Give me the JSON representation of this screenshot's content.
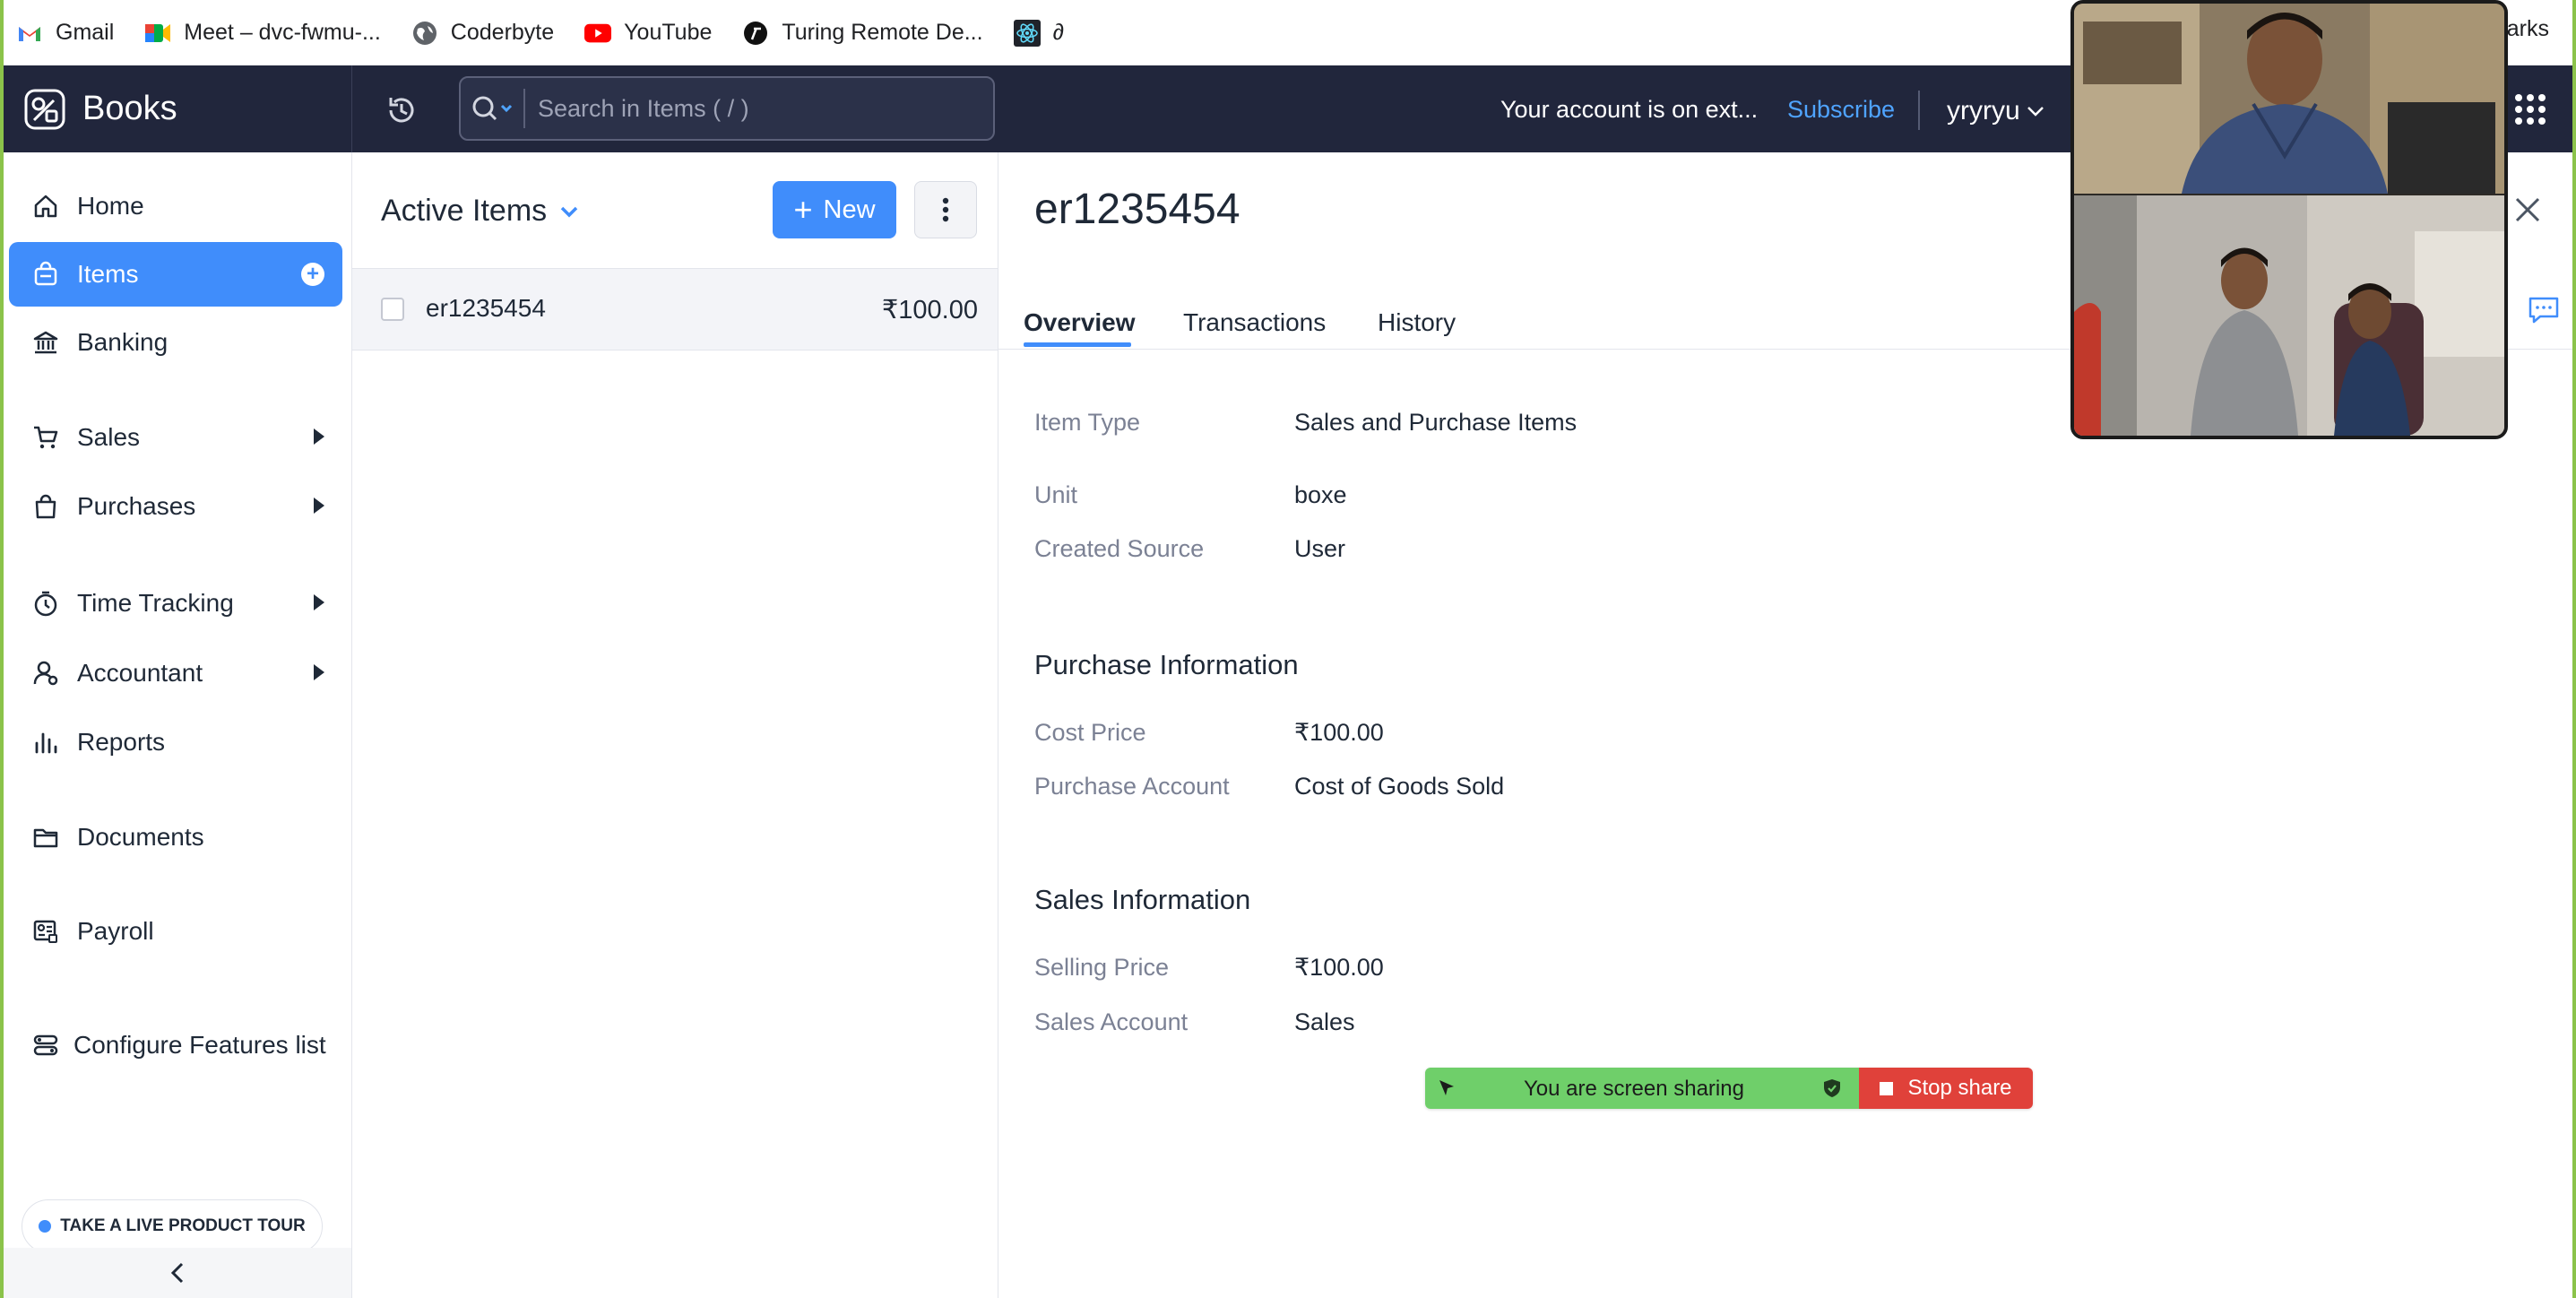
{
  "bookmarks": [
    {
      "label": "Gmail",
      "icon": "gmail-icon"
    },
    {
      "label": "Meet – dvc-fwmu-...",
      "icon": "meet-icon"
    },
    {
      "label": "Coderbyte",
      "icon": "globe-icon"
    },
    {
      "label": "YouTube",
      "icon": "youtube-icon"
    },
    {
      "label": "Turing Remote De...",
      "icon": "turing-icon"
    },
    {
      "label": "∂",
      "icon": "react-icon"
    }
  ],
  "bookmarks_right": "arks",
  "topbar": {
    "app_name": "Books",
    "search_placeholder": "Search in Items ( / )",
    "trial_text": "Your account is on ext...",
    "subscribe_label": "Subscribe",
    "org_name": "yryryu"
  },
  "sidebar": {
    "items": [
      {
        "label": "Home",
        "icon": "home-icon"
      },
      {
        "label": "Items",
        "icon": "items-bag-icon",
        "active": true
      },
      {
        "label": "Banking",
        "icon": "bank-icon"
      },
      {
        "label": "Sales",
        "icon": "cart-icon"
      },
      {
        "label": "Purchases",
        "icon": "shopping-bag-icon"
      },
      {
        "label": "Time Tracking",
        "icon": "timer-icon"
      },
      {
        "label": "Accountant",
        "icon": "accountant-icon"
      },
      {
        "label": "Reports",
        "icon": "bar-chart-icon"
      },
      {
        "label": "Documents",
        "icon": "folder-icon"
      },
      {
        "label": "Payroll",
        "icon": "payroll-icon"
      },
      {
        "label": "Configure Features list",
        "icon": "configure-icon"
      }
    ],
    "tour_label": "TAKE A LIVE PRODUCT TOUR"
  },
  "list": {
    "title": "Active Items",
    "new_label": "New",
    "rows": [
      {
        "name": "er1235454",
        "price": "₹100.00"
      }
    ]
  },
  "detail": {
    "title": "er1235454",
    "tabs": [
      "Overview",
      "Transactions",
      "History"
    ],
    "fields": [
      {
        "label": "Item Type",
        "value": "Sales and Purchase Items"
      },
      {
        "label": "Unit",
        "value": "boxe"
      },
      {
        "label": "Created Source",
        "value": "User"
      }
    ],
    "purchase": {
      "heading": "Purchase Information",
      "fields": [
        {
          "label": "Cost Price",
          "value": "₹100.00"
        },
        {
          "label": "Purchase Account",
          "value": "Cost of Goods Sold"
        }
      ]
    },
    "sales": {
      "heading": "Sales Information",
      "fields": [
        {
          "label": "Selling Price",
          "value": "₹100.00"
        },
        {
          "label": "Sales Account",
          "value": "Sales"
        }
      ]
    }
  },
  "sharebar": {
    "status_text": "You are screen sharing",
    "stop_label": "Stop share"
  },
  "colors": {
    "accent": "#408dfb",
    "topbar_bg": "#21263c",
    "share_green": "#6fcf6a",
    "share_red": "#e0413a"
  }
}
